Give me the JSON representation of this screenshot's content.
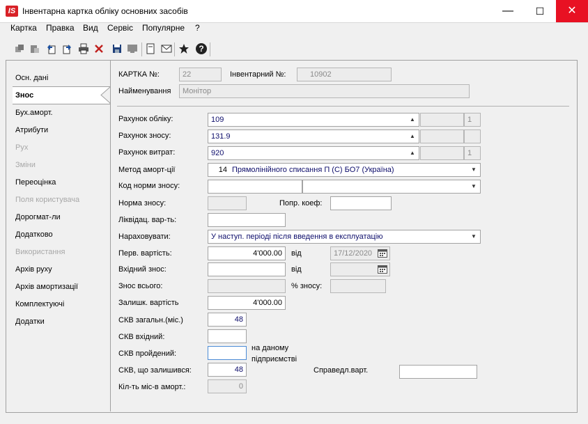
{
  "window": {
    "logo": "IS",
    "title": "Інвентарна картка обліку основних засобів",
    "minimize": "—",
    "maximize": "☐",
    "close": "✕"
  },
  "menu": [
    "Картка",
    "Правка",
    "Вид",
    "Сервіс",
    "Популярне",
    "?"
  ],
  "toolbar": {
    "icons": [
      "copy-icon",
      "paste-icon",
      "undo-icon",
      "redo-icon",
      "print-icon",
      "delete-icon",
      "save-icon",
      "monitor-icon",
      "doc-icon",
      "mail-icon",
      "star-icon",
      "help-icon"
    ]
  },
  "sidebar": [
    {
      "label": "Осн. дані",
      "state": "normal"
    },
    {
      "label": "Знос",
      "state": "active"
    },
    {
      "label": "Бух.аморт.",
      "state": "normal"
    },
    {
      "label": "Атрибути",
      "state": "normal"
    },
    {
      "label": "Рух",
      "state": "disabled"
    },
    {
      "label": "Зміни",
      "state": "disabled"
    },
    {
      "label": "Переоцінка",
      "state": "normal"
    },
    {
      "label": "Поля користувача",
      "state": "disabled"
    },
    {
      "label": "Дорогмат-ли",
      "state": "normal"
    },
    {
      "label": "Додатково",
      "state": "normal"
    },
    {
      "label": "Використання",
      "state": "disabled"
    },
    {
      "label": "Архів руху",
      "state": "normal"
    },
    {
      "label": "Архів амортизації",
      "state": "normal"
    },
    {
      "label": "Комплектуючі",
      "state": "normal"
    },
    {
      "label": "Додатки",
      "state": "normal"
    }
  ],
  "card": {
    "card_no_label": "КАРТКА №:",
    "card_no": "22",
    "inv_no_label": "Інвентарний №:",
    "inv_no": "10902",
    "name_label": "Найменування",
    "name": "Монітор"
  },
  "form": {
    "account_label": "Рахунок обліку:",
    "account": "109",
    "account_extra": "1",
    "wear_account_label": "Рахунок зносу:",
    "wear_account": "131.9",
    "expense_account_label": "Рахунок витрат:",
    "expense_account": "920",
    "expense_extra": "1",
    "method_label": "Метод аморт-ції",
    "method_code": "14",
    "method_name": "Прямолінійного списання П (С) БО7 (Україна)",
    "norm_code_label": "Код норми зносу:",
    "norm_label": "Норма зносу:",
    "coef_label": "Попр. коеф:",
    "liquid_label": "Ліквідац. вар-ть:",
    "accrue_label": "Нараховувати:",
    "accrue_value": "У наступ. періоді після введення в експлуатацію",
    "initial_cost_label": "Перв. вартість:",
    "initial_cost": "4'000.00",
    "from_label": "від",
    "initial_date": "17/12/2020",
    "incoming_wear_label": "Вхідний знос:",
    "from_label2": "від",
    "total_wear_label": "Знос всього:",
    "wear_pct_label": "% зносу:",
    "residual_label": "Залишк. вартість",
    "residual_cost": "4'000.00",
    "skv_total_label": "СКВ загальн.(міс.)",
    "skv_total": "48",
    "skv_incoming_label": "СКВ вхідний:",
    "skv_passed_label": "СКВ пройдений:",
    "at_enterprise_line1": "на даному",
    "at_enterprise_line2": "підприємстві",
    "skv_left_label": "СКВ, що залишився:",
    "skv_left": "48",
    "fair_value_label": "Справедл.варт.",
    "months_count_label": "Кіл-ть міс-в аморт.:",
    "months_count": "0"
  }
}
